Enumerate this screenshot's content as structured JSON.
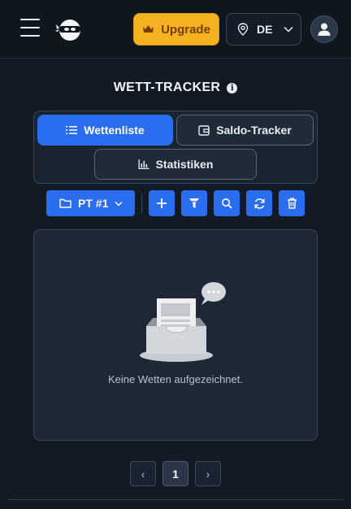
{
  "header": {
    "upgrade_label": "Upgrade",
    "language": "DE"
  },
  "page": {
    "title": "WETT-TRACKER"
  },
  "tabs": [
    {
      "label": "Wettenliste",
      "icon": "list-icon",
      "active": true
    },
    {
      "label": "Saldo-Tracker",
      "icon": "wallet-icon",
      "active": false
    },
    {
      "label": "Statistiken",
      "icon": "bar-chart-icon",
      "active": false
    }
  ],
  "toolbar": {
    "folder_label": "PT #1",
    "buttons": [
      "plus-icon",
      "filter-icon",
      "search-icon",
      "refresh-icon",
      "trash-icon"
    ]
  },
  "empty_state": {
    "message": "Keine Wetten aufgezeichnet."
  },
  "pagination": {
    "prev": "‹",
    "current": "1",
    "next": "›"
  },
  "colors": {
    "background": "#121b25",
    "accent": "#2b6def",
    "upgrade": "#f4b220"
  }
}
